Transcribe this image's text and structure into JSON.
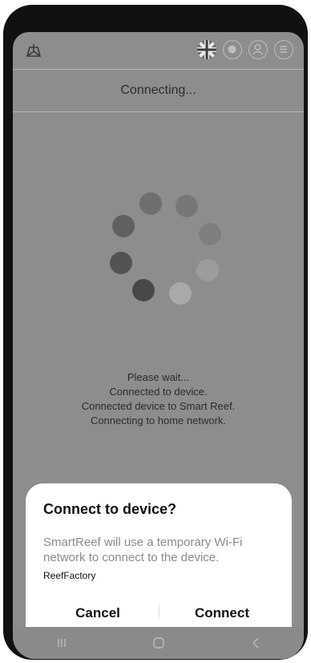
{
  "header": {
    "title": "Connecting..."
  },
  "topbar": {
    "icons": [
      "logo-icon",
      "uk-flag-icon",
      "globe-icon",
      "user-icon",
      "menu-icon"
    ]
  },
  "status": {
    "lines": [
      "Please wait...",
      "Connected to device.",
      "Connected device to Smart Reef.",
      "Connecting to home network."
    ]
  },
  "dialog": {
    "title": "Connect to device?",
    "message": "SmartReef will use a temporary Wi-Fi network to connect to the device.",
    "network": "ReefFactory",
    "cancel_label": "Cancel",
    "connect_label": "Connect"
  },
  "navbar": {
    "icons": [
      "recent-apps-icon",
      "home-icon",
      "back-icon"
    ]
  },
  "colors": {
    "dim_background": "#8d8d8d",
    "dialog_bg": "#ffffff"
  }
}
